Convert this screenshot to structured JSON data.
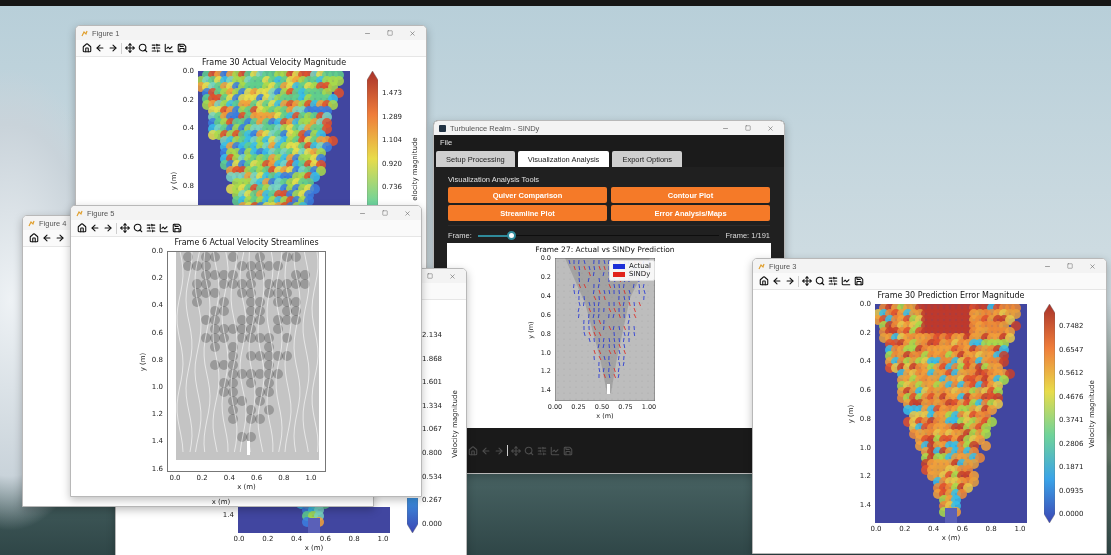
{
  "windows": [
    {
      "kind": "figure",
      "plot": {
        "kind": "heatmap",
        "yticks": [
          "1.4"
        ],
        "xticks": [
          "0.0",
          "0.2",
          "0.4",
          "0.6",
          "0.8",
          "1.0"
        ],
        "xlabel": "x (m)",
        "colorbar": {
          "label": "Velocity magnitude",
          "ticks": [
            "2.134",
            "1.868",
            "1.601",
            "1.334",
            "1.067",
            "0.800",
            "0.534",
            "0.267",
            "0.000"
          ]
        }
      }
    },
    {
      "kind": "figure",
      "title": "Figure 1",
      "plot": {
        "kind": "heatmap",
        "title": "Frame 30 Actual Velocity Magnitude",
        "ylabel": "y (m)",
        "yticks": [
          "0.0",
          "0.2",
          "0.4",
          "0.6",
          "0.8"
        ],
        "colorbar": {
          "label": "elocity magnitude",
          "ticks": [
            "1.473",
            "1.289",
            "1.104",
            "0.920",
            "0.736"
          ]
        }
      }
    },
    {
      "kind": "app",
      "title": "Turbulence Realm - SINDy",
      "menu": [
        "File"
      ],
      "tabs": [
        {
          "label": "Setup Processing",
          "selected": false
        },
        {
          "label": "Visualization Analysis",
          "selected": true
        },
        {
          "label": "Export Options",
          "selected": false
        }
      ],
      "tools": {
        "title": "Visualization Analysis Tools",
        "buttons": [
          "Quiver Comparison",
          "Contour Plot",
          "Streamline Plot",
          "Error Analysis/Maps"
        ]
      },
      "slider": {
        "label": "Frame:",
        "level": 0.14,
        "reading": "Frame: 1/191"
      },
      "plot": {
        "kind": "quiver",
        "title": "Frame 27: Actual vs SINDy Prediction",
        "ylabel": "y (m)",
        "yticks": [
          "0.0",
          "0.2",
          "0.4",
          "0.6",
          "0.8",
          "1.0",
          "1.2",
          "1.4"
        ],
        "xticks": [
          "0.00",
          "0.25",
          "0.50",
          "0.75",
          "1.00"
        ],
        "xlabel": "x (m)",
        "legend": [
          {
            "label": "Actual",
            "color": "#1c2fd8"
          },
          {
            "label": "SINDy",
            "color": "#e0221c"
          }
        ]
      }
    },
    {
      "kind": "figure",
      "title": "Figure 4",
      "plot": {
        "kind": "blank",
        "xlabel": "x (m)"
      }
    },
    {
      "kind": "figure",
      "title": "Figure 5",
      "plot": {
        "kind": "streamlines",
        "title": "Frame 6 Actual Velocity Streamlines",
        "ylabel": "y (m)",
        "yticks": [
          "0.0",
          "0.2",
          "0.4",
          "0.6",
          "0.8",
          "1.0",
          "1.2",
          "1.4",
          "1.6"
        ],
        "xticks": [
          "0.0",
          "0.2",
          "0.4",
          "0.6",
          "0.8",
          "1.0"
        ],
        "xlabel": "x (m)"
      }
    },
    {
      "kind": "figure",
      "title": "Figure 3",
      "plot": {
        "kind": "heatmap",
        "title": "Frame 30 Prediction Error Magnitude",
        "ylabel": "y (m)",
        "yticks": [
          "0.0",
          "0.2",
          "0.4",
          "0.6",
          "0.8",
          "1.0",
          "1.2",
          "1.4"
        ],
        "xticks": [
          "0.0",
          "0.2",
          "0.4",
          "0.6",
          "0.8",
          "1.0"
        ],
        "xlabel": "x (m)",
        "colorbar": {
          "label": "Velocity magnitude",
          "ticks": [
            "0.7482",
            "0.6547",
            "0.5612",
            "0.4676",
            "0.3741",
            "0.2806",
            "0.1871",
            "0.0935",
            "0.0000"
          ]
        }
      }
    }
  ]
}
